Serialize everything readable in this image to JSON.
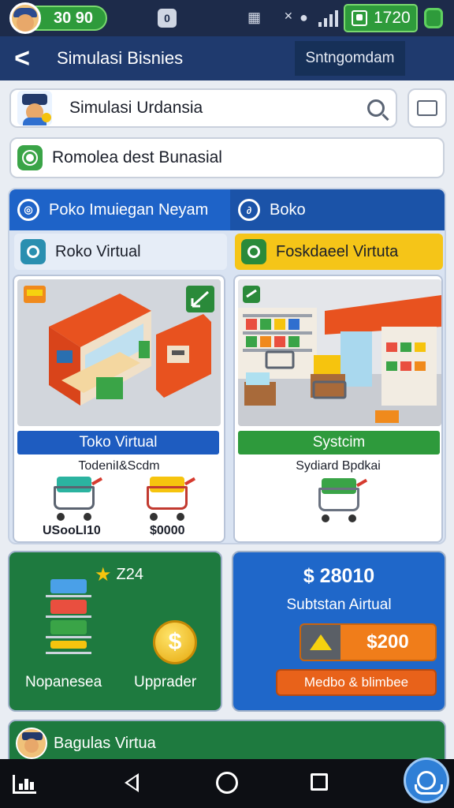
{
  "status": {
    "coins": "30 90",
    "money": "1720"
  },
  "appbar": {
    "title": "Simulasi Bisnies",
    "action_label": "Sntngomdam"
  },
  "search_row": {
    "label": "Simulasi Urdansia"
  },
  "promo_row": {
    "label": "Romolea dest Bunasial"
  },
  "tabs": [
    {
      "label": "Poko Imuiegan Neyam",
      "icon": "location-icon"
    },
    {
      "label": "Boko",
      "icon": "swirl-icon"
    }
  ],
  "store_a": {
    "header": "Roko Virtual",
    "banner": "Toko Virtual",
    "caption": "TodeniI&Scdm",
    "cart1_price": "USooLI10",
    "cart2_price": "$0000",
    "colors": {
      "banner": "#1e5cc0"
    }
  },
  "store_b": {
    "header": "Foskdaeel Virtuta",
    "banner": "Systcim",
    "caption": "Sydiard Bpdkai",
    "colors": {
      "banner": "#2e9a3c",
      "header": "#f5c518"
    }
  },
  "upgrades": {
    "stars": "Z24",
    "left_label": "Nopanesea",
    "right_label": "Upprader"
  },
  "market": {
    "amount": "$ 28010",
    "subtitle": "Subtstan Airtual",
    "upgrade_value": "$200",
    "button": "Medbo & blimbee"
  },
  "footer": {
    "label": "Bagulas Virtua"
  }
}
